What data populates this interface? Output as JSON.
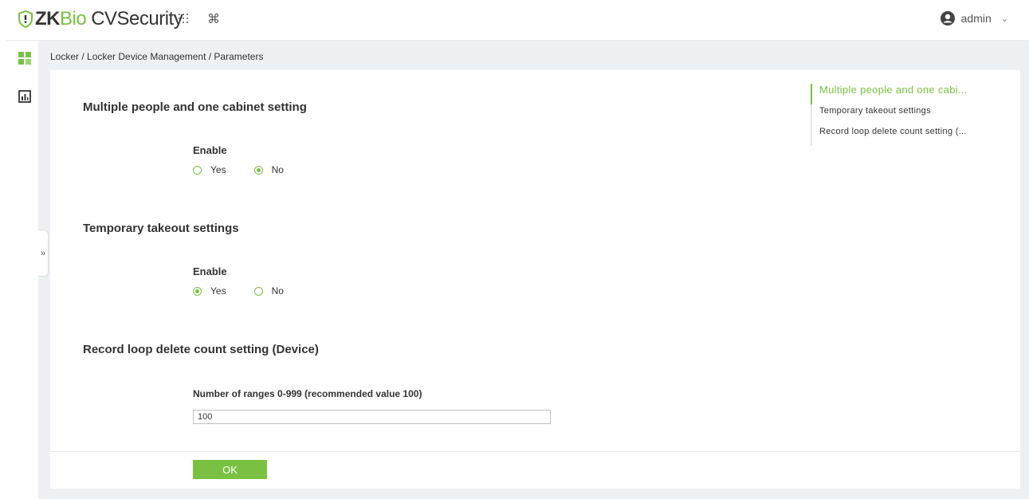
{
  "app": {
    "logo_zk": "ZK",
    "logo_bio": "Bio",
    "logo_cv": "CVSecurity",
    "brand_color": "#7ac143"
  },
  "header": {
    "apps_icon": "grid-dots-icon",
    "command_icon": "command-icon",
    "user_name": "admin",
    "user_icon": "user-circle-icon",
    "user_menu_icon": "chevron-down-icon"
  },
  "rail": {
    "icons": [
      "modules-grid-icon",
      "report-chart-icon"
    ]
  },
  "breadcrumb": "Locker / Locker Device Management / Parameters",
  "sections": [
    {
      "title": "Multiple people and one cabinet setting",
      "field_label": "Enable",
      "options": [
        "Yes",
        "No"
      ],
      "selected": "No"
    },
    {
      "title": "Temporary takeout settings",
      "field_label": "Enable",
      "options": [
        "Yes",
        "No"
      ],
      "selected": "Yes"
    },
    {
      "title": "Record loop delete count setting (Device)",
      "field_label": "Number of ranges 0-999 (recommended value 100)",
      "input_value": "100"
    }
  ],
  "anchor_nav": [
    {
      "label": "Multiple people and one cabi...",
      "active": true
    },
    {
      "label": "Temporary takeout settings",
      "active": false
    },
    {
      "label": "Record loop delete count setting (...",
      "active": false
    }
  ],
  "ok_label": "OK",
  "collapse_glyph": "»"
}
